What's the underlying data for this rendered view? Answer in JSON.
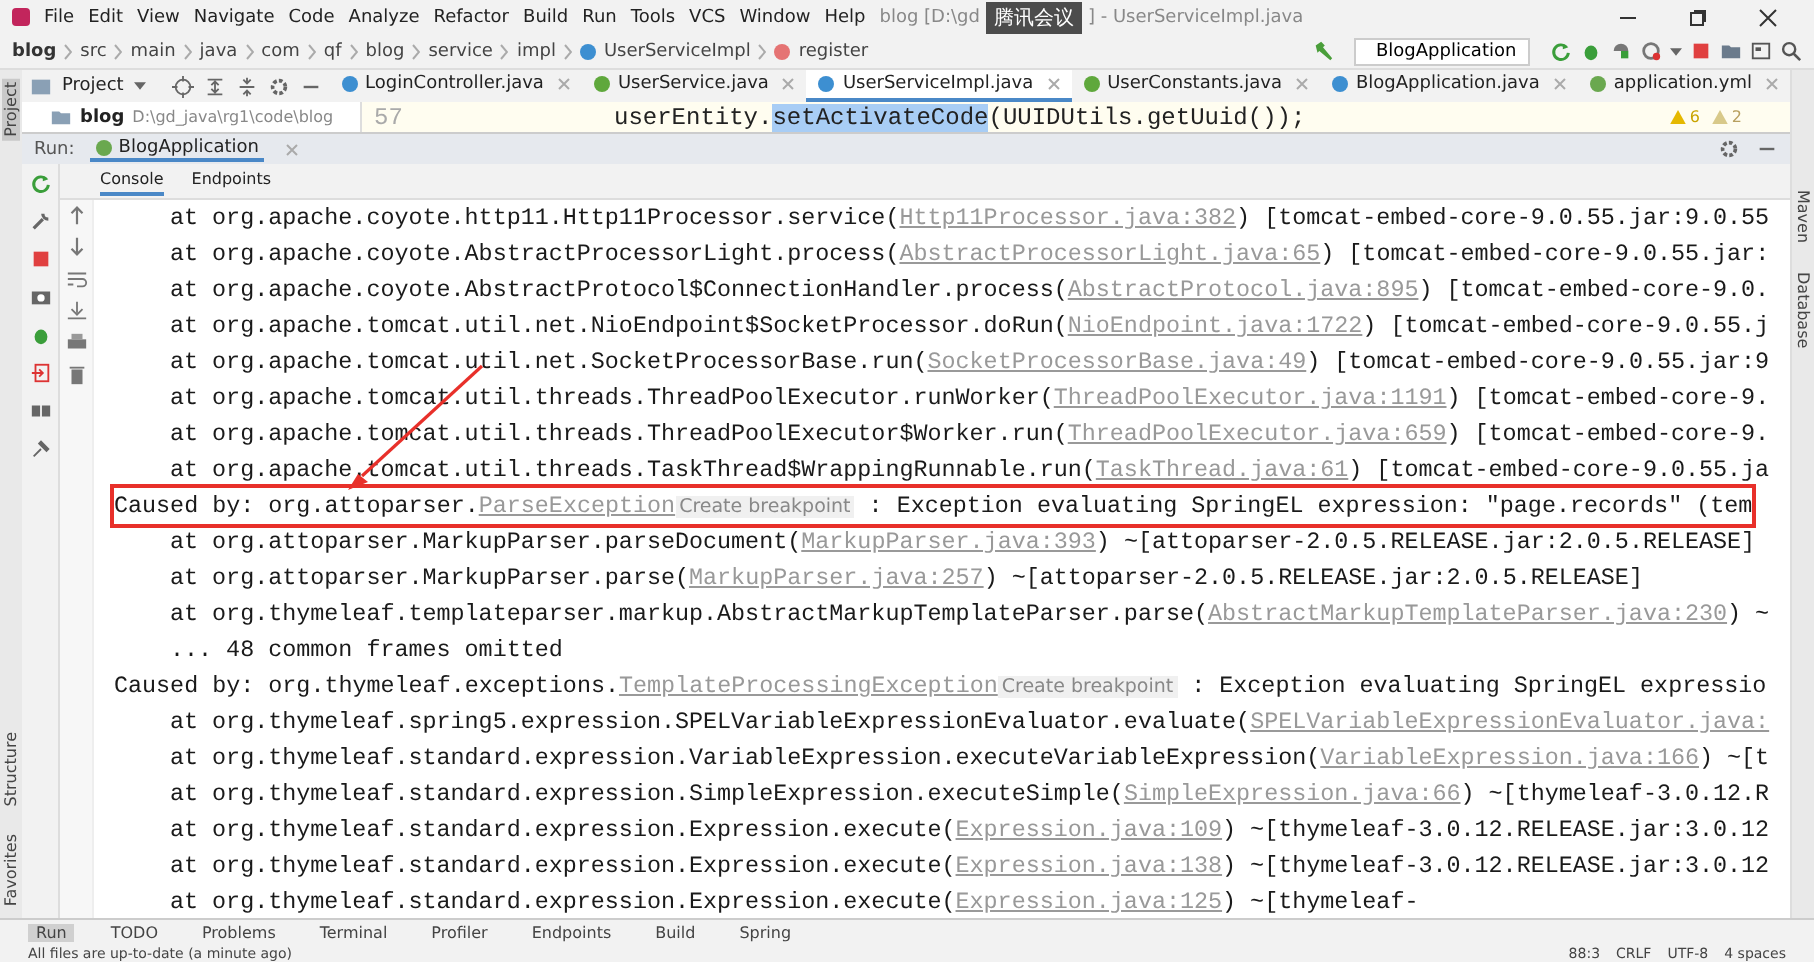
{
  "window": {
    "title_start": "blog [D:\\gd",
    "title_end": "] - UserServiceImpl.java"
  },
  "overlay_badge": {
    "label": "腾讯会议"
  },
  "menu": [
    "File",
    "Edit",
    "View",
    "Navigate",
    "Code",
    "Analyze",
    "Refactor",
    "Build",
    "Run",
    "Tools",
    "VCS",
    "Window",
    "Help"
  ],
  "breadcrumb": [
    {
      "label": "blog",
      "kind": "project"
    },
    {
      "label": "src",
      "kind": "folder"
    },
    {
      "label": "main",
      "kind": "folder"
    },
    {
      "label": "java",
      "kind": "folder"
    },
    {
      "label": "com",
      "kind": "folder"
    },
    {
      "label": "qf",
      "kind": "folder"
    },
    {
      "label": "blog",
      "kind": "folder"
    },
    {
      "label": "service",
      "kind": "folder"
    },
    {
      "label": "impl",
      "kind": "folder"
    },
    {
      "label": "UserServiceImpl",
      "kind": "class"
    },
    {
      "label": "register",
      "kind": "method"
    }
  ],
  "run_config": {
    "label": "BlogApplication"
  },
  "project_panel": {
    "title": "Project",
    "root": {
      "name": "blog",
      "path": "D:\\gd_java\\rg1\\code\\blog"
    }
  },
  "editor_tabs": [
    {
      "label": "LoginController.java",
      "kind": "class",
      "selected": false
    },
    {
      "label": "UserService.java",
      "kind": "interface",
      "selected": false
    },
    {
      "label": "UserServiceImpl.java",
      "kind": "class",
      "selected": true
    },
    {
      "label": "UserConstants.java",
      "kind": "interface",
      "selected": false
    },
    {
      "label": "BlogApplication.java",
      "kind": "app",
      "selected": false
    },
    {
      "label": "application.yml",
      "kind": "yml",
      "selected": false
    }
  ],
  "editor": {
    "line_number": "57",
    "code_start": "userEntity.",
    "code_selected": "setActivateCode",
    "code_end": "(UUIDUtils.getUuid());",
    "warnings": "6",
    "weak_warnings": "2"
  },
  "run_panel": {
    "label": "Run:",
    "tab": "BlogApplication"
  },
  "console_tabs": [
    {
      "label": "Console",
      "selected": true
    },
    {
      "label": "Endpoints",
      "selected": false
    }
  ],
  "console_lines": [
    {
      "indent": true,
      "highlighted": false,
      "segments": [
        {
          "kind": "text",
          "text": "at org.apache.coyote.http11.Http11Processor.service("
        },
        {
          "kind": "link",
          "text": "Http11Processor.java:382"
        },
        {
          "kind": "text",
          "text": ") [tomcat-embed-core-9.0.55.jar:9.0.55"
        }
      ]
    },
    {
      "indent": true,
      "highlighted": false,
      "segments": [
        {
          "kind": "text",
          "text": "at org.apache.coyote.AbstractProcessorLight.process("
        },
        {
          "kind": "link",
          "text": "AbstractProcessorLight.java:65"
        },
        {
          "kind": "text",
          "text": ") [tomcat-embed-core-9.0.55.jar:"
        }
      ]
    },
    {
      "indent": true,
      "highlighted": false,
      "segments": [
        {
          "kind": "text",
          "text": "at org.apache.coyote.AbstractProtocol$ConnectionHandler.process("
        },
        {
          "kind": "link",
          "text": "AbstractProtocol.java:895"
        },
        {
          "kind": "text",
          "text": ") [tomcat-embed-core-9.0."
        }
      ]
    },
    {
      "indent": true,
      "highlighted": false,
      "segments": [
        {
          "kind": "text",
          "text": "at org.apache.tomcat.util.net.NioEndpoint$SocketProcessor.doRun("
        },
        {
          "kind": "link",
          "text": "NioEndpoint.java:1722"
        },
        {
          "kind": "text",
          "text": ") [tomcat-embed-core-9.0.55.j"
        }
      ]
    },
    {
      "indent": true,
      "highlighted": false,
      "segments": [
        {
          "kind": "text",
          "text": "at org.apache.tomcat.util.net.SocketProcessorBase.run("
        },
        {
          "kind": "link",
          "text": "SocketProcessorBase.java:49"
        },
        {
          "kind": "text",
          "text": ") [tomcat-embed-core-9.0.55.jar:9"
        }
      ]
    },
    {
      "indent": true,
      "highlighted": false,
      "segments": [
        {
          "kind": "text",
          "text": "at org.apache.tomcat.util.threads.ThreadPoolExecutor.runWorker("
        },
        {
          "kind": "link",
          "text": "ThreadPoolExecutor.java:1191"
        },
        {
          "kind": "text",
          "text": ") [tomcat-embed-core-9."
        }
      ]
    },
    {
      "indent": true,
      "highlighted": false,
      "segments": [
        {
          "kind": "text",
          "text": "at org.apache.tomcat.util.threads.ThreadPoolExecutor$Worker.run("
        },
        {
          "kind": "link",
          "text": "ThreadPoolExecutor.java:659"
        },
        {
          "kind": "text",
          "text": ") [tomcat-embed-core-9."
        }
      ]
    },
    {
      "indent": true,
      "highlighted": false,
      "segments": [
        {
          "kind": "text",
          "text": "at org.apache.tomcat.util.threads.TaskThread$WrappingRunnable.run("
        },
        {
          "kind": "link",
          "text": "TaskThread.java:61"
        },
        {
          "kind": "text",
          "text": ") [tomcat-embed-core-9.0.55.ja"
        }
      ]
    },
    {
      "indent": false,
      "highlighted": true,
      "segments": [
        {
          "kind": "text",
          "text": "Caused by: org.attoparser."
        },
        {
          "kind": "link",
          "text": "ParseException"
        },
        {
          "kind": "hint",
          "text": "Create breakpoint"
        },
        {
          "kind": "text",
          "text": " : Exception evaluating SpringEL expression: \"page.records\" (tem"
        }
      ]
    },
    {
      "indent": true,
      "highlighted": false,
      "segments": [
        {
          "kind": "text",
          "text": "at org.attoparser.MarkupParser.parseDocument("
        },
        {
          "kind": "link",
          "text": "MarkupParser.java:393"
        },
        {
          "kind": "text",
          "text": ") ~[attoparser-2.0.5.RELEASE.jar:2.0.5.RELEASE]"
        }
      ]
    },
    {
      "indent": true,
      "highlighted": false,
      "segments": [
        {
          "kind": "text",
          "text": "at org.attoparser.MarkupParser.parse("
        },
        {
          "kind": "link",
          "text": "MarkupParser.java:257"
        },
        {
          "kind": "text",
          "text": ") ~[attoparser-2.0.5.RELEASE.jar:2.0.5.RELEASE]"
        }
      ]
    },
    {
      "indent": true,
      "highlighted": false,
      "segments": [
        {
          "kind": "text",
          "text": "at org.thymeleaf.templateparser.markup.AbstractMarkupTemplateParser.parse("
        },
        {
          "kind": "link",
          "text": "AbstractMarkupTemplateParser.java:230"
        },
        {
          "kind": "text",
          "text": ") ~"
        }
      ]
    },
    {
      "indent": true,
      "highlighted": false,
      "segments": [
        {
          "kind": "text",
          "text": "... 48 common frames omitted"
        }
      ]
    },
    {
      "indent": false,
      "highlighted": false,
      "segments": [
        {
          "kind": "text",
          "text": "Caused by: org.thymeleaf.exceptions."
        },
        {
          "kind": "link",
          "text": "TemplateProcessingException"
        },
        {
          "kind": "hint",
          "text": "Create breakpoint"
        },
        {
          "kind": "text",
          "text": " : Exception evaluating SpringEL expressio"
        }
      ]
    },
    {
      "indent": true,
      "highlighted": false,
      "segments": [
        {
          "kind": "text",
          "text": "at org.thymeleaf.spring5.expression.SPELVariableExpressionEvaluator.evaluate("
        },
        {
          "kind": "link",
          "text": "SPELVariableExpressionEvaluator.java:"
        }
      ]
    },
    {
      "indent": true,
      "highlighted": false,
      "segments": [
        {
          "kind": "text",
          "text": "at org.thymeleaf.standard.expression.VariableExpression.executeVariableExpression("
        },
        {
          "kind": "link",
          "text": "VariableExpression.java:166"
        },
        {
          "kind": "text",
          "text": ") ~[t"
        }
      ]
    },
    {
      "indent": true,
      "highlighted": false,
      "segments": [
        {
          "kind": "text",
          "text": "at org.thymeleaf.standard.expression.SimpleExpression.executeSimple("
        },
        {
          "kind": "link",
          "text": "SimpleExpression.java:66"
        },
        {
          "kind": "text",
          "text": ") ~[thymeleaf-3.0.12.R"
        }
      ]
    },
    {
      "indent": true,
      "highlighted": false,
      "segments": [
        {
          "kind": "text",
          "text": "at org.thymeleaf.standard.expression.Expression.execute("
        },
        {
          "kind": "link",
          "text": "Expression.java:109"
        },
        {
          "kind": "text",
          "text": ") ~[thymeleaf-3.0.12.RELEASE.jar:3.0.12"
        }
      ]
    },
    {
      "indent": true,
      "highlighted": false,
      "segments": [
        {
          "kind": "text",
          "text": "at org.thymeleaf.standard.expression.Expression.execute("
        },
        {
          "kind": "link",
          "text": "Expression.java:138"
        },
        {
          "kind": "text",
          "text": ") ~[thymeleaf-3.0.12.RELEASE.jar:3.0.12"
        }
      ]
    },
    {
      "indent": true,
      "highlighted": false,
      "segments": [
        {
          "kind": "text",
          "text": "at org.thymeleaf.standard.expression.Expression.execute("
        },
        {
          "kind": "link",
          "text": "Expression.java:125"
        },
        {
          "kind": "text",
          "text": ") ~[thymeleaf-"
        }
      ]
    }
  ],
  "bottom_tabs": [
    {
      "label": "Run",
      "selected": true
    },
    {
      "label": "TODO",
      "selected": false
    },
    {
      "label": "Problems",
      "selected": false
    },
    {
      "label": "Terminal",
      "selected": false
    },
    {
      "label": "Profiler",
      "selected": false
    },
    {
      "label": "Endpoints",
      "selected": false
    },
    {
      "label": "Build",
      "selected": false
    },
    {
      "label": "Spring",
      "selected": false
    }
  ],
  "left_strip": {
    "top": "Project",
    "bottom": [
      "Structure",
      "Favorites"
    ]
  },
  "right_strip": [
    "Maven",
    "Database"
  ],
  "status_bar": {
    "message": "All files are up-to-date (a minute ago)",
    "position": "88:3",
    "line_separator": "CRLF",
    "encoding": "UTF-8",
    "indent": "4 spaces"
  }
}
